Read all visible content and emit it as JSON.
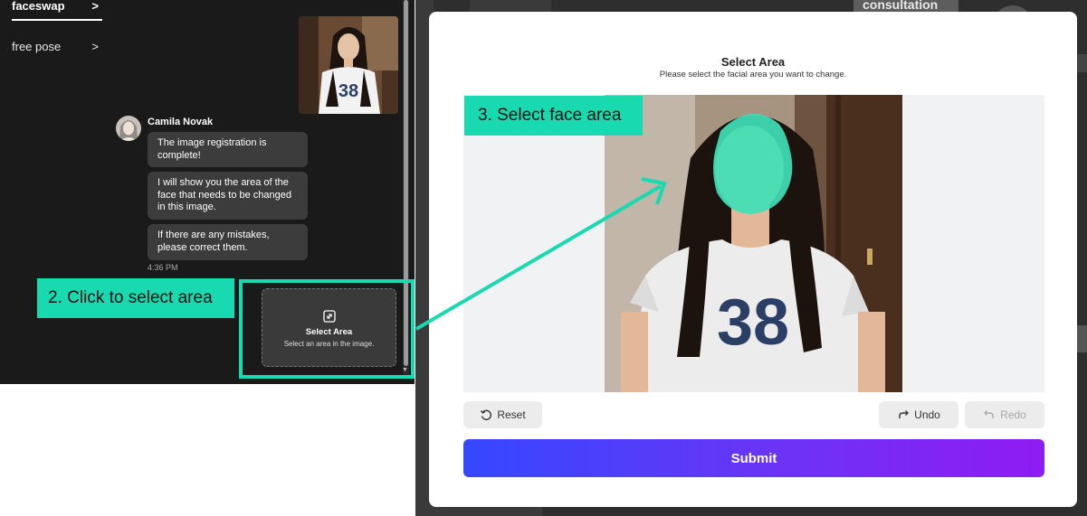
{
  "nav": {
    "items": [
      {
        "label": "faceswap",
        "chevron": ">"
      },
      {
        "label": "free pose",
        "chevron": ">"
      }
    ]
  },
  "chat": {
    "sender_name": "Camila Novak",
    "messages": [
      "The image registration is complete!",
      "I will show you the area of the face that needs to be changed in this image.",
      "If there are any mistakes, please correct them."
    ],
    "time": "4:36 PM",
    "select_card": {
      "title": "Select Area",
      "subtitle": "Select an area in the image.",
      "icon": "expand-icon"
    }
  },
  "annotations": {
    "step2": "2. Click to select area",
    "step3": "3. Select face area",
    "accent_color": "#19d9b0"
  },
  "backdrop": {
    "word": "consultation"
  },
  "modal": {
    "title": "Select Area",
    "subtitle": "Please select the facial area you want to change.",
    "buttons": {
      "reset": "Reset",
      "undo": "Undo",
      "redo": "Redo",
      "submit": "Submit"
    },
    "shirt_number": "38",
    "submit_gradient": [
      "#3548ff",
      "#8f1bf3"
    ]
  }
}
